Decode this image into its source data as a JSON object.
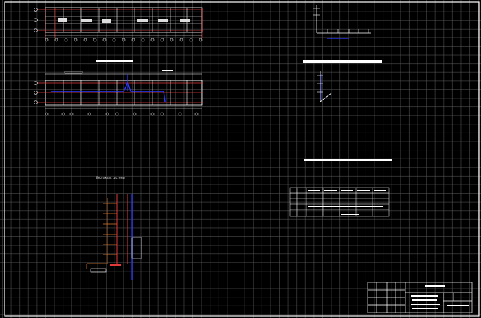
{
  "drawing": {
    "background": "#000000",
    "grid_color": "#5a5a5a",
    "line_colors": {
      "outline": "#ffffff",
      "axis": "#e23a3a",
      "pipe": "#2b3bff",
      "riser": "#e07a2a",
      "label_bar": "#ffffff"
    }
  },
  "views": {
    "riser_view": {
      "title": "Вертикаль системы"
    }
  },
  "title_block": {
    "name": "title-block"
  }
}
